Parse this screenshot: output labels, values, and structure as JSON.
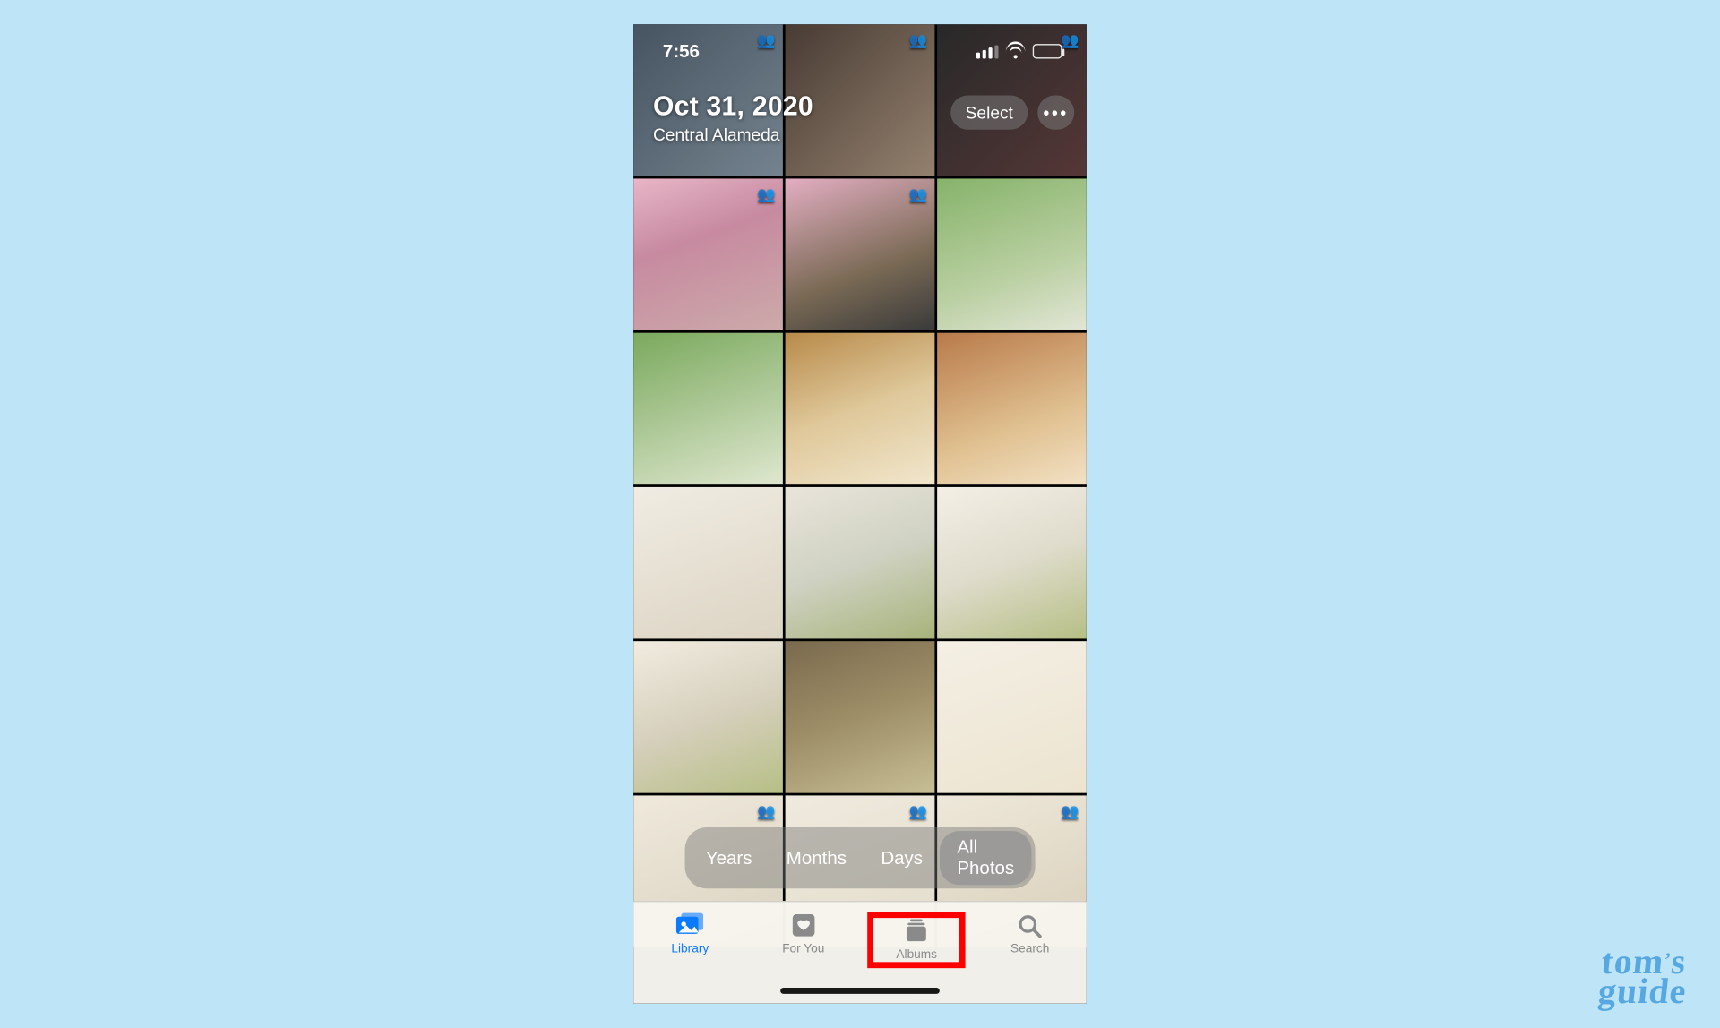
{
  "statusbar": {
    "time": "7:56"
  },
  "header": {
    "date": "Oct 31, 2020",
    "location": "Central Alameda",
    "select_label": "Select"
  },
  "segmented": {
    "items": [
      "Years",
      "Months",
      "Days",
      "All Photos"
    ],
    "selected_index": 3
  },
  "tabs": {
    "items": [
      "Library",
      "For You",
      "Albums",
      "Search"
    ],
    "active_index": 0,
    "highlight_index": 2
  },
  "grid": {
    "rows": 7,
    "cols": 3,
    "people_badge_cells": [
      0,
      1,
      2,
      3,
      4,
      18,
      19,
      20
    ]
  },
  "watermark": {
    "line1": "tom",
    "apostrophe": "’",
    "line1b": "s",
    "line2": "guide"
  },
  "icons": {
    "more": "•••"
  }
}
